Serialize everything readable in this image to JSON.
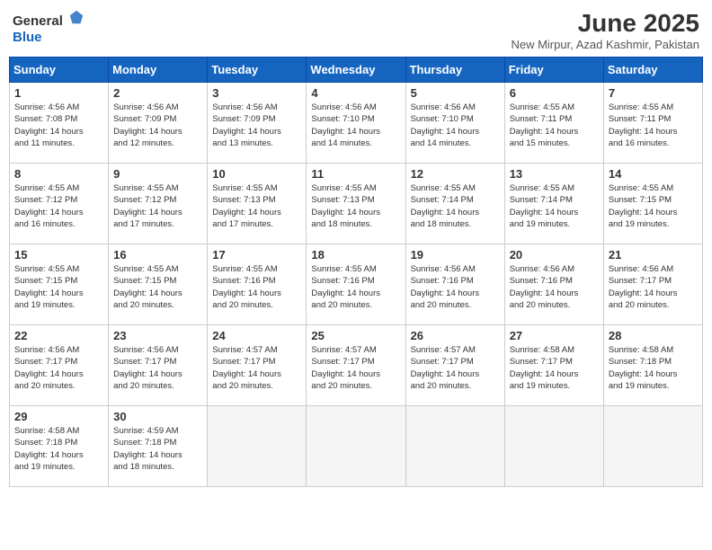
{
  "header": {
    "logo_general": "General",
    "logo_blue": "Blue",
    "title": "June 2025",
    "subtitle": "New Mirpur, Azad Kashmir, Pakistan"
  },
  "days_of_week": [
    "Sunday",
    "Monday",
    "Tuesday",
    "Wednesday",
    "Thursday",
    "Friday",
    "Saturday"
  ],
  "weeks": [
    [
      {
        "day": 1,
        "sunrise": "4:56 AM",
        "sunset": "7:08 PM",
        "daylight": "14 hours and 11 minutes."
      },
      {
        "day": 2,
        "sunrise": "4:56 AM",
        "sunset": "7:09 PM",
        "daylight": "14 hours and 12 minutes."
      },
      {
        "day": 3,
        "sunrise": "4:56 AM",
        "sunset": "7:09 PM",
        "daylight": "14 hours and 13 minutes."
      },
      {
        "day": 4,
        "sunrise": "4:56 AM",
        "sunset": "7:10 PM",
        "daylight": "14 hours and 14 minutes."
      },
      {
        "day": 5,
        "sunrise": "4:56 AM",
        "sunset": "7:10 PM",
        "daylight": "14 hours and 14 minutes."
      },
      {
        "day": 6,
        "sunrise": "4:55 AM",
        "sunset": "7:11 PM",
        "daylight": "14 hours and 15 minutes."
      },
      {
        "day": 7,
        "sunrise": "4:55 AM",
        "sunset": "7:11 PM",
        "daylight": "14 hours and 16 minutes."
      }
    ],
    [
      {
        "day": 8,
        "sunrise": "4:55 AM",
        "sunset": "7:12 PM",
        "daylight": "14 hours and 16 minutes."
      },
      {
        "day": 9,
        "sunrise": "4:55 AM",
        "sunset": "7:12 PM",
        "daylight": "14 hours and 17 minutes."
      },
      {
        "day": 10,
        "sunrise": "4:55 AM",
        "sunset": "7:13 PM",
        "daylight": "14 hours and 17 minutes."
      },
      {
        "day": 11,
        "sunrise": "4:55 AM",
        "sunset": "7:13 PM",
        "daylight": "14 hours and 18 minutes."
      },
      {
        "day": 12,
        "sunrise": "4:55 AM",
        "sunset": "7:14 PM",
        "daylight": "14 hours and 18 minutes."
      },
      {
        "day": 13,
        "sunrise": "4:55 AM",
        "sunset": "7:14 PM",
        "daylight": "14 hours and 19 minutes."
      },
      {
        "day": 14,
        "sunrise": "4:55 AM",
        "sunset": "7:15 PM",
        "daylight": "14 hours and 19 minutes."
      }
    ],
    [
      {
        "day": 15,
        "sunrise": "4:55 AM",
        "sunset": "7:15 PM",
        "daylight": "14 hours and 19 minutes."
      },
      {
        "day": 16,
        "sunrise": "4:55 AM",
        "sunset": "7:15 PM",
        "daylight": "14 hours and 20 minutes."
      },
      {
        "day": 17,
        "sunrise": "4:55 AM",
        "sunset": "7:16 PM",
        "daylight": "14 hours and 20 minutes."
      },
      {
        "day": 18,
        "sunrise": "4:55 AM",
        "sunset": "7:16 PM",
        "daylight": "14 hours and 20 minutes."
      },
      {
        "day": 19,
        "sunrise": "4:56 AM",
        "sunset": "7:16 PM",
        "daylight": "14 hours and 20 minutes."
      },
      {
        "day": 20,
        "sunrise": "4:56 AM",
        "sunset": "7:16 PM",
        "daylight": "14 hours and 20 minutes."
      },
      {
        "day": 21,
        "sunrise": "4:56 AM",
        "sunset": "7:17 PM",
        "daylight": "14 hours and 20 minutes."
      }
    ],
    [
      {
        "day": 22,
        "sunrise": "4:56 AM",
        "sunset": "7:17 PM",
        "daylight": "14 hours and 20 minutes."
      },
      {
        "day": 23,
        "sunrise": "4:56 AM",
        "sunset": "7:17 PM",
        "daylight": "14 hours and 20 minutes."
      },
      {
        "day": 24,
        "sunrise": "4:57 AM",
        "sunset": "7:17 PM",
        "daylight": "14 hours and 20 minutes."
      },
      {
        "day": 25,
        "sunrise": "4:57 AM",
        "sunset": "7:17 PM",
        "daylight": "14 hours and 20 minutes."
      },
      {
        "day": 26,
        "sunrise": "4:57 AM",
        "sunset": "7:17 PM",
        "daylight": "14 hours and 20 minutes."
      },
      {
        "day": 27,
        "sunrise": "4:58 AM",
        "sunset": "7:17 PM",
        "daylight": "14 hours and 19 minutes."
      },
      {
        "day": 28,
        "sunrise": "4:58 AM",
        "sunset": "7:18 PM",
        "daylight": "14 hours and 19 minutes."
      }
    ],
    [
      {
        "day": 29,
        "sunrise": "4:58 AM",
        "sunset": "7:18 PM",
        "daylight": "14 hours and 19 minutes."
      },
      {
        "day": 30,
        "sunrise": "4:59 AM",
        "sunset": "7:18 PM",
        "daylight": "14 hours and 18 minutes."
      },
      null,
      null,
      null,
      null,
      null
    ]
  ]
}
